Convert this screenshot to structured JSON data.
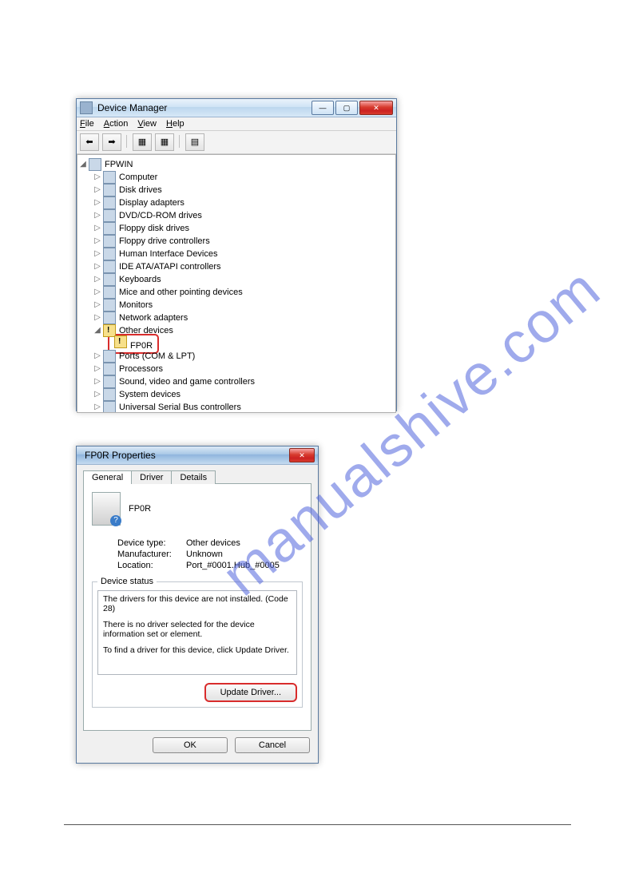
{
  "watermark": "manualshive.com",
  "dm": {
    "title": "Device Manager",
    "menu": [
      "File",
      "Action",
      "View",
      "Help"
    ],
    "root": "FPWIN",
    "items": [
      "Computer",
      "Disk drives",
      "Display adapters",
      "DVD/CD-ROM drives",
      "Floppy disk drives",
      "Floppy drive controllers",
      "Human Interface Devices",
      "IDE ATA/ATAPI controllers",
      "Keyboards",
      "Mice and other pointing devices",
      "Monitors",
      "Network adapters"
    ],
    "other_devices": "Other devices",
    "fp0r": "FP0R",
    "items2": [
      "Ports (COM & LPT)",
      "Processors",
      "Sound, video and game controllers",
      "System devices",
      "Universal Serial Bus controllers"
    ]
  },
  "prop": {
    "title": "FP0R Properties",
    "tabs": [
      "General",
      "Driver",
      "Details"
    ],
    "dev_name": "FP0R",
    "kv": {
      "type_k": "Device type:",
      "type_v": "Other devices",
      "mfr_k": "Manufacturer:",
      "mfr_v": "Unknown",
      "loc_k": "Location:",
      "loc_v": "Port_#0001.Hub_#0005"
    },
    "status_legend": "Device status",
    "status1": "The drivers for this device are not installed. (Code 28)",
    "status2": "There is no driver selected for the device information set or element.",
    "status3": "To find a driver for this device, click Update Driver.",
    "update_btn": "Update Driver...",
    "ok": "OK",
    "cancel": "Cancel"
  }
}
